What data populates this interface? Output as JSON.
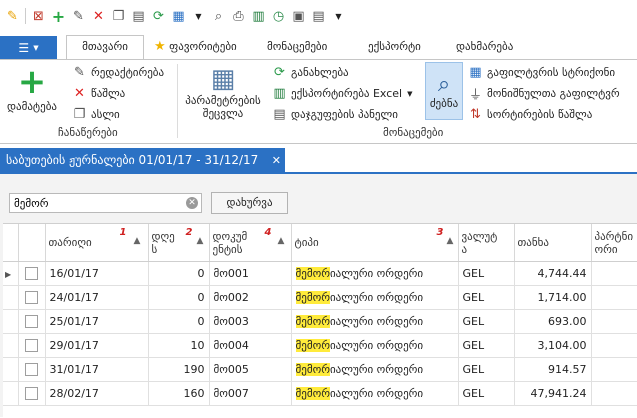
{
  "quick_access_icons": [
    "app-logo-icon",
    "delete-doc-icon",
    "add-icon",
    "edit-icon",
    "delete-icon",
    "copy-icon",
    "document-icon",
    "refresh-icon",
    "grid-icon",
    "preview-icon",
    "print-icon",
    "excel-icon",
    "history-icon",
    "layout-icon",
    "qat-menu-icon"
  ],
  "tabs": {
    "file_icon": "☰",
    "items": [
      {
        "label": "მთავარი",
        "active": true
      },
      {
        "label": "ფავორიტები",
        "active": false
      },
      {
        "label": "მონაცემები",
        "active": false
      },
      {
        "label": "ექსპორტი",
        "active": false
      },
      {
        "label": "დახმარება",
        "active": false
      }
    ]
  },
  "ribbon": {
    "add_label": "დამატება",
    "edit_label": "რედაქტირება",
    "delete_label": "წაშლა",
    "copy_label": "ასლი",
    "group1_label": "ჩანაწერები",
    "params_label_1": "პარამეტრების",
    "params_label_2": "შეცვლა",
    "refresh_label": "განახლება",
    "export_excel_label": "ექსპორტირება Excel",
    "grouping_label": "დაჯგუფების პანელი",
    "search_label": "ძებნა",
    "filter_row_label": "გაფილტვრის სტრიქონი",
    "marked_filter_label": "მონიშნულთა გაფილტვრ",
    "delete_sort_label": "სორტირების წაშლა",
    "group2_label": "მონაცემები"
  },
  "document_tab": {
    "title": "საბუთების ჟურნალები 01/01/17 - 31/12/17",
    "close": "✕"
  },
  "search": {
    "value": "მემორ",
    "placeholder": "",
    "close_button": "დახურვა"
  },
  "table": {
    "columns": [
      "თარიღი",
      "დღე ს",
      "დოკუმ ენტის",
      "ტიპი",
      "ვალუტ ა",
      "თანხა",
      "პარტნი ორი"
    ],
    "badges": [
      "1",
      "2",
      "4",
      "3"
    ],
    "highlight": "მემორ",
    "rows": [
      {
        "date": "16/01/17",
        "days": "0",
        "doc": "მო001",
        "type_hl": "მემორ",
        "type_rest": "იალური ორდერი",
        "currency": "GEL",
        "amount": "4,744.44"
      },
      {
        "date": "24/01/17",
        "days": "0",
        "doc": "მო002",
        "type_hl": "მემორ",
        "type_rest": "იალური ორდერი",
        "currency": "GEL",
        "amount": "1,714.00"
      },
      {
        "date": "25/01/17",
        "days": "0",
        "doc": "მო003",
        "type_hl": "მემორ",
        "type_rest": "იალური ორდერი",
        "currency": "GEL",
        "amount": "693.00"
      },
      {
        "date": "29/01/17",
        "days": "10",
        "doc": "მო004",
        "type_hl": "მემორ",
        "type_rest": "იალური ორდერი",
        "currency": "GEL",
        "amount": "3,104.00"
      },
      {
        "date": "31/01/17",
        "days": "190",
        "doc": "მო005",
        "type_hl": "მემორ",
        "type_rest": "იალური ორდერი",
        "currency": "GEL",
        "amount": "914.57"
      },
      {
        "date": "28/02/17",
        "days": "160",
        "doc": "მო007",
        "type_hl": "მემორ",
        "type_rest": "იალური ორდერი",
        "currency": "GEL",
        "amount": "47,941.24"
      }
    ]
  }
}
